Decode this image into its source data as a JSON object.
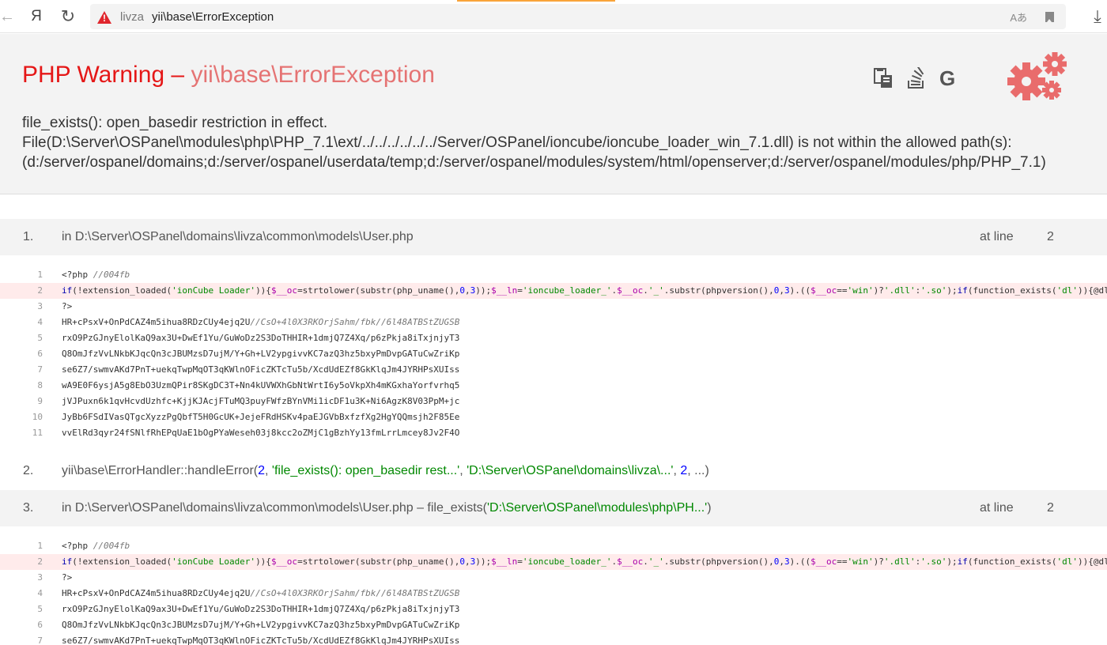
{
  "browser": {
    "back_icon": "←",
    "yandex_icon": "Я",
    "reload_icon": "↻",
    "download_icon": "⤓",
    "warning_icon": "!",
    "translate_icon": "Aあ",
    "address_domain": "livza",
    "address_title": "yii\\base\\ErrorException"
  },
  "error": {
    "title_prefix": "PHP Warning – ",
    "title_class": "yii\\base\\ErrorException",
    "message_lines": [
      "file_exists(): open_basedir restriction in effect.",
      "File(D:\\Server\\OSPanel\\modules\\php\\PHP_7.1\\ext/../../../../../../Server/OSPanel/ioncube/ioncube_loader_win_7.1.dll) is not within the allowed path(s):",
      "(d:/server/ospanel/domains;d:/server/ospanel/userdata/temp;d:/server/ospanel/modules/system/html/openserver;d:/server/ospanel/modules/php/PHP_7.1)"
    ],
    "tool_google_label": "G"
  },
  "stack": {
    "at_line_label": "at line",
    "calls": [
      {
        "num": "1.",
        "text": "in D:\\Server\\OSPanel\\domains\\livza\\common\\models\\User.php",
        "line": "2"
      },
      {
        "num": "2.",
        "fn": "yii\\base\\ErrorHandler::handleError(",
        "a1": "2",
        "sep1": ", ",
        "a2": "'file_exists(): open_basedir rest...'",
        "sep2": ", ",
        "a3": "'D:\\Server\\OSPanel\\domains\\livza\\...'",
        "sep3": ", ",
        "a4": "2",
        "tail": ", ...)"
      },
      {
        "num": "3.",
        "text": "in D:\\Server\\OSPanel\\domains\\livza\\common\\models\\User.php – file_exists(",
        "arg": "'D:\\Server\\OSPanel\\modules\\php\\PH...'",
        "close": ")",
        "line": "2"
      }
    ]
  },
  "code": {
    "l1_a": "<?php ",
    "l1_b": "//004fb",
    "l2": {
      "p1": "if",
      "p2": "(!extension_loaded(",
      "p3": "'ionCube Loader'",
      "p4": ")){",
      "p5": "$__oc",
      "p6": "=strtolower(substr(php_uname(),",
      "p7": "0",
      "p8": ",",
      "p9": "3",
      "p10": "));",
      "p11": "$__ln",
      "p12": "=",
      "p13": "'ioncube_loader_'",
      "p14": ".",
      "p15": "$__oc",
      "p16": ".",
      "p17": "'_'",
      "p18": ".substr(phpversion(),",
      "p19": "0",
      "p20": ",",
      "p21": "3",
      "p22": ").((",
      "p23": "$__oc",
      "p24": "==",
      "p25": "'win'",
      "p26": ")?",
      "p27": "'.dll'",
      "p28": ":",
      "p29": "'.so'",
      "p30": ");",
      "p31": "if",
      "p32": "(function_exists(",
      "p33": "'dl'",
      "p34": ")){@dl("
    },
    "l3": "?>",
    "l4_a": "HR+cPsxV+OnPdCAZ4m5ihua8RDzCUy4ejq2U",
    "l4_b": "//CsO+4l0X3RKOrjSahm/fbk//6l48ATBStZUGSB",
    "l5": "rxO9PzGJnyElolKaQ9ax3U+DwEf1Yu/GuWoDz2S3DoTHHIR+1dmjQ7Z4Xq/p6zPkja8iTxjnjyT3",
    "l6": "Q8OmJfzVvLNkbKJqcQn3cJBUMzsD7ujM/Y+Gh+LV2ypgivvKC7azQ3hz5bxyPmDvpGATuCwZriKp",
    "l7": "se6Z7/swmvAKd7PnT+uekqTwpMqOT3qKWlnOFicZKTcTu5b/XcdUdEZf8GkKlqJm4JYRHPsXUIss",
    "l8": "wA9E0F6ysjA5g8EbO3UzmQPir8SKgDC3T+Nn4kUVWXhGbNtWrtI6y5oVkpXh4mKGxhaYorfvrhq5",
    "l9": "jVJPuxn6k1qvHcvdUzhfc+KjjKJAcjFTuMQ3puyFWfzBYnVMi1icDF1u3K+Ni6AgzK8V03PpM+jc",
    "l10": "JyBb6FSdIVasQTgcXyzzPgQbfT5H0GcUK+JejeFRdHSKv4paEJGVbBxfzfXg2HgYQQmsjh2F85Ee",
    "l11": "vvElRd3qyr24fSNlfRhEPqUaE1bOgPYaWeseh03j8kcc2oZMjC1gBzhYy13fmLrrLmcey8Jv2F4O",
    "line_numbers": [
      "1",
      "2",
      "3",
      "4",
      "5",
      "6",
      "7",
      "8",
      "9",
      "10",
      "11"
    ]
  }
}
